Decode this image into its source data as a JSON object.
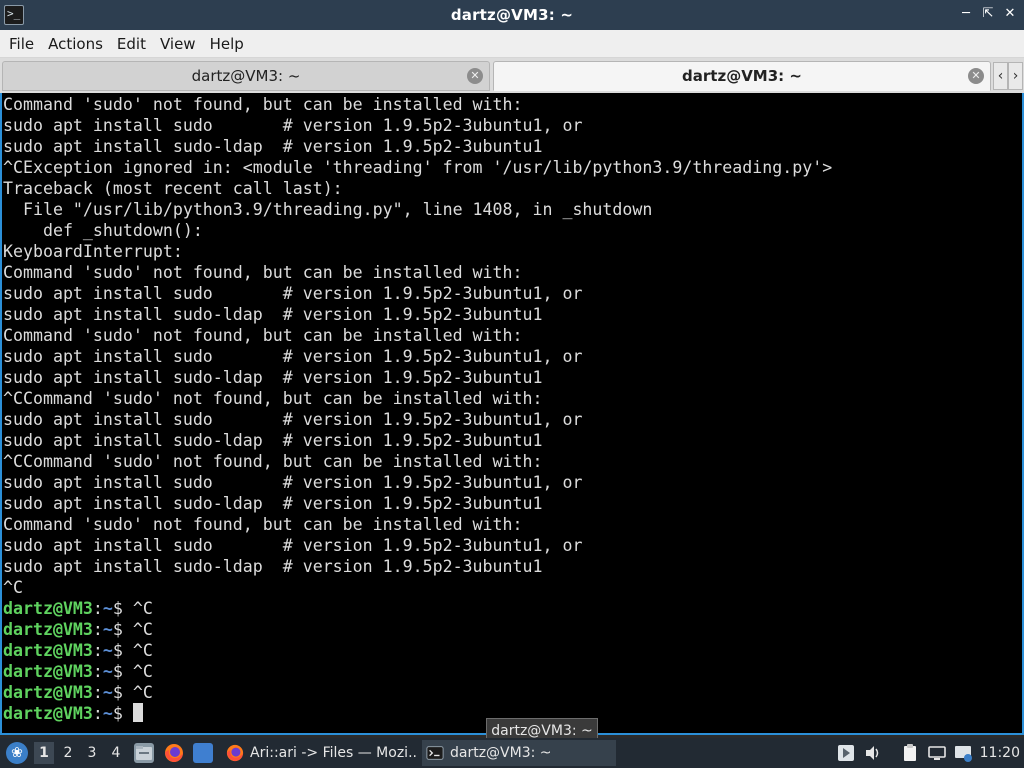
{
  "window": {
    "title": "dartz@VM3: ~",
    "app_icon": "terminal-icon",
    "controls": [
      "minimize-icon",
      "maximize-icon",
      "close-icon"
    ]
  },
  "menubar": {
    "items": [
      "File",
      "Actions",
      "Edit",
      "View",
      "Help"
    ]
  },
  "tabs": [
    {
      "label": "dartz@VM3: ~",
      "active": false
    },
    {
      "label": "dartz@VM3: ~",
      "active": true
    }
  ],
  "terminal": {
    "colors": {
      "background": "#000000",
      "text": "#dcdcdc",
      "user": "#5fd35f",
      "path": "#5c8fd6"
    },
    "output_lines": [
      "Command 'sudo' not found, but can be installed with:",
      "sudo apt install sudo       # version 1.9.5p2-3ubuntu1, or",
      "sudo apt install sudo-ldap  # version 1.9.5p2-3ubuntu1",
      "^CException ignored in: <module 'threading' from '/usr/lib/python3.9/threading.py'>",
      "Traceback (most recent call last):",
      "  File \"/usr/lib/python3.9/threading.py\", line 1408, in _shutdown",
      "    def _shutdown():",
      "KeyboardInterrupt:",
      "Command 'sudo' not found, but can be installed with:",
      "sudo apt install sudo       # version 1.9.5p2-3ubuntu1, or",
      "sudo apt install sudo-ldap  # version 1.9.5p2-3ubuntu1",
      "Command 'sudo' not found, but can be installed with:",
      "sudo apt install sudo       # version 1.9.5p2-3ubuntu1, or",
      "sudo apt install sudo-ldap  # version 1.9.5p2-3ubuntu1",
      "^CCommand 'sudo' not found, but can be installed with:",
      "sudo apt install sudo       # version 1.9.5p2-3ubuntu1, or",
      "sudo apt install sudo-ldap  # version 1.9.5p2-3ubuntu1",
      "^CCommand 'sudo' not found, but can be installed with:",
      "sudo apt install sudo       # version 1.9.5p2-3ubuntu1, or",
      "sudo apt install sudo-ldap  # version 1.9.5p2-3ubuntu1",
      "Command 'sudo' not found, but can be installed with:",
      "sudo apt install sudo       # version 1.9.5p2-3ubuntu1, or",
      "sudo apt install sudo-ldap  # version 1.9.5p2-3ubuntu1",
      "^C"
    ],
    "prompt": {
      "user_host": "dartz@VM3",
      "colon": ":",
      "path": "~",
      "symbol": "$"
    },
    "prompt_lines": [
      {
        "input": " ^C"
      },
      {
        "input": " ^C"
      },
      {
        "input": " ^C"
      },
      {
        "input": " ^C"
      },
      {
        "input": " ^C"
      },
      {
        "input": " ",
        "cursor": true
      }
    ]
  },
  "tooltip": {
    "text": "dartz@VM3: ~"
  },
  "taskbar": {
    "start_icon": "lxqt-menu-icon",
    "workspaces": [
      "1",
      "2",
      "3",
      "4"
    ],
    "active_workspace": "1",
    "launchers": [
      "file-manager-icon",
      "firefox-icon",
      "show-desktop-icon"
    ],
    "tasks": [
      {
        "label": "Ari::ari -> Files — Mozi...",
        "icon": "firefox-icon",
        "active": false
      },
      {
        "label": "dartz@VM3: ~",
        "icon": "terminal-icon",
        "active": true
      }
    ],
    "tray": [
      "media-player-icon",
      "volume-icon",
      "clipboard-icon",
      "network-icon",
      "removable-media-icon"
    ],
    "clock": "11:20"
  }
}
